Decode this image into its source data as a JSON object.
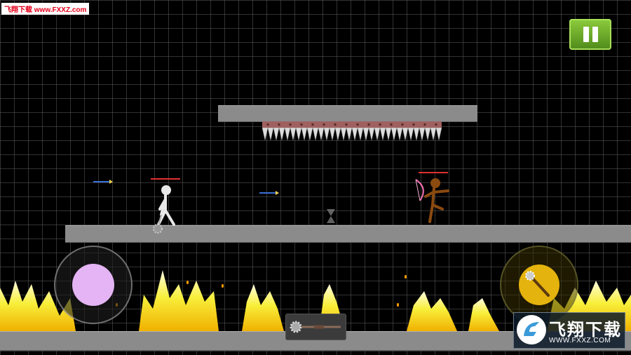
{
  "watermark_top_left": "飞翔下载 www.FXXZ.com",
  "pause_button": {
    "icon": "pause-icon",
    "color": "#6aad28"
  },
  "player": {
    "name": "white-stickman",
    "weapon": "spiked-mace",
    "color": "#e8e8e8"
  },
  "enemy": {
    "name": "orange-stickman",
    "weapon": "bow",
    "color": "#8a4a10"
  },
  "joystick": {
    "knob_color": "#e4b4f4"
  },
  "attack_button": {
    "icon": "mace-icon",
    "color": "#e5b30d"
  },
  "weapon_slot": {
    "icon": "spiked-mace-icon"
  },
  "watermark_logo": {
    "title": "飞翔下载",
    "url": "WWW.FXXZ.COM"
  },
  "colors": {
    "platform": "#8b8b8b",
    "fire": "#f8ef3a",
    "health": "#e03030"
  }
}
